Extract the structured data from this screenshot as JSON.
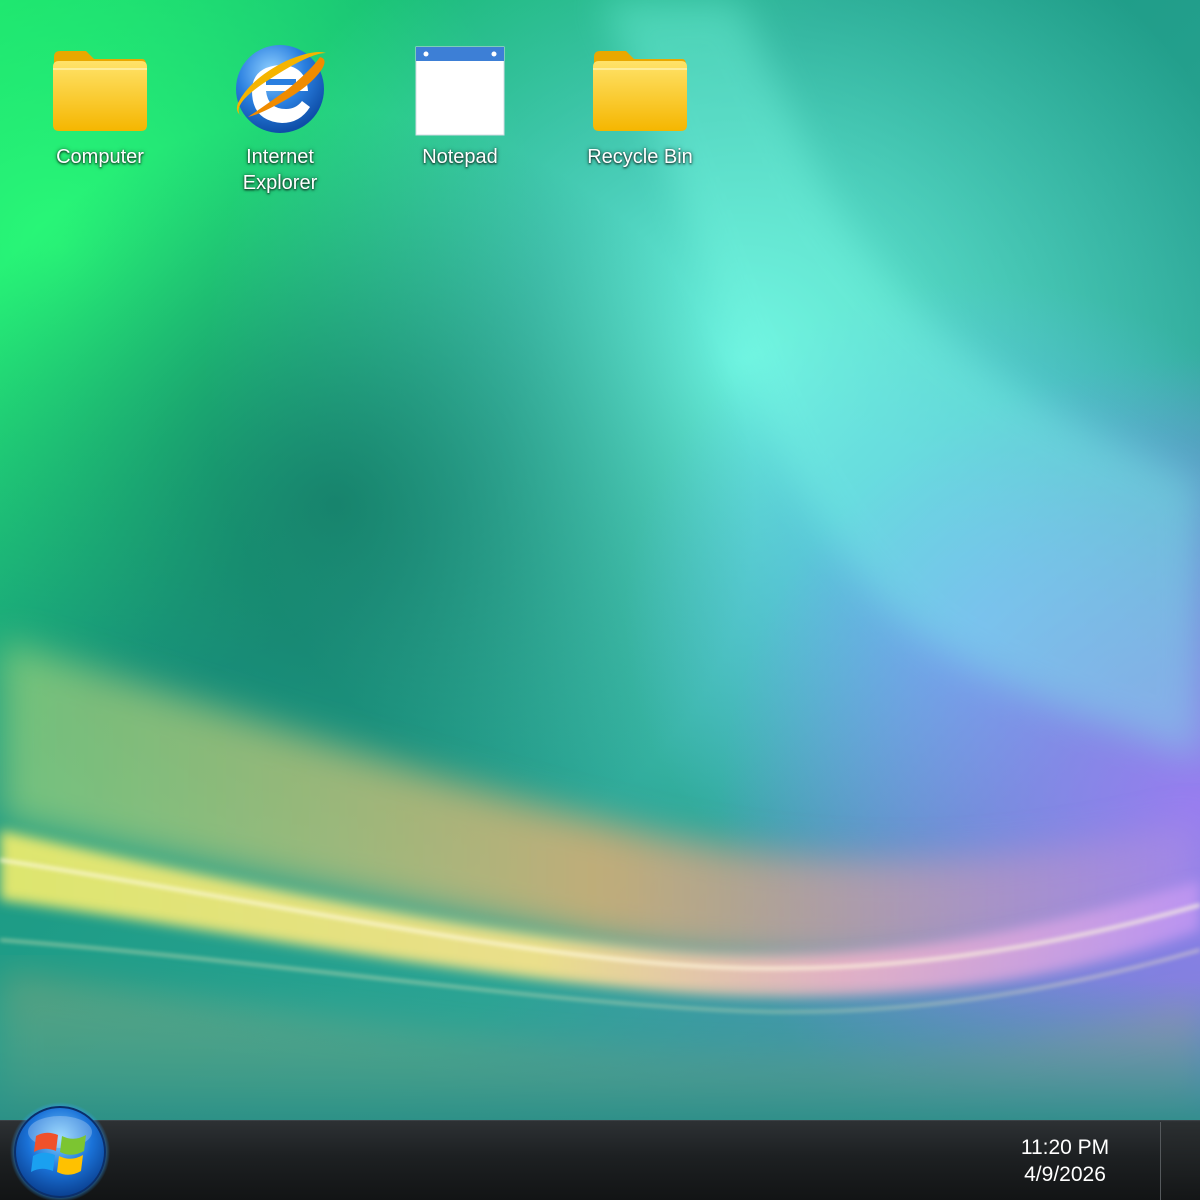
{
  "desktop": {
    "icons": [
      {
        "label": "Computer",
        "icon": "folder-icon"
      },
      {
        "label": "Internet\nExplorer",
        "icon": "internet-explorer-icon"
      },
      {
        "label": "Notepad",
        "icon": "notepad-icon"
      },
      {
        "label": "Recycle Bin",
        "icon": "folder-icon"
      }
    ]
  },
  "taskbar": {
    "start_icon": "windows-logo-icon",
    "clock": {
      "time": "11:20 PM",
      "date": "4/9/2026"
    }
  },
  "colors": {
    "taskbar": "#1d2022",
    "folder": "#f7c21a",
    "ie_blue": "#1f6fd1",
    "ie_ring": "#f5b400"
  }
}
